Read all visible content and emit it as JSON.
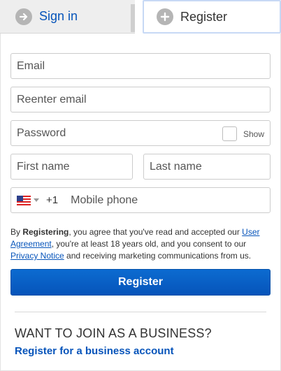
{
  "tabs": {
    "signin_label": "Sign in",
    "register_label": "Register"
  },
  "form": {
    "email_placeholder": "Email",
    "reenter_email_placeholder": "Reenter email",
    "password_placeholder": "Password",
    "show_label": "Show",
    "first_name_placeholder": "First name",
    "last_name_placeholder": "Last name",
    "country_code": "+1",
    "mobile_placeholder": "Mobile phone"
  },
  "legal": {
    "prefix": "By ",
    "bold": "Registering",
    "part1": ", you agree that you've read and accepted our ",
    "user_agreement": "User Agreement",
    "part2": ", you're at least 18 years old, and you consent to our ",
    "privacy_notice": "Privacy Notice",
    "part3": " and receiving marketing communications from us."
  },
  "register_button": "Register",
  "business": {
    "title": "WANT TO JOIN AS A BUSINESS?",
    "link": "Register for a business account"
  },
  "colors": {
    "link_blue": "#0654ba",
    "button_blue": "#0654ba"
  },
  "icons": {
    "signin": "arrow-right-circle-icon",
    "register": "plus-circle-icon",
    "flag": "us-flag-icon"
  }
}
